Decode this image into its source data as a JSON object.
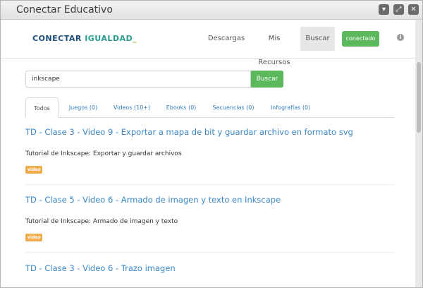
{
  "window": {
    "title": "Conectar Educativo",
    "buttons": [
      "▾",
      "⤢",
      "✕"
    ]
  },
  "header": {
    "logo": [
      "CONECTAR ",
      "IGUALDAD",
      "_"
    ],
    "nav": [
      "Descargas",
      "Mis Recursos",
      "Buscar"
    ],
    "status_button": "conectado",
    "info_icon": "i"
  },
  "search": {
    "value": "inkscape",
    "button": "Buscar"
  },
  "tabs": [
    "Todos",
    "Juegos (0)",
    "Videos (10+)",
    "Ebooks (0)",
    "Secuencias (0)",
    "Infografías (0)"
  ],
  "results": [
    {
      "title": "TD - Clase 3 - Video 9 - Exportar a mapa de bit y guardar archivo en formato svg",
      "description": "Tutorial de Inkscape: Exportar y guardar archivos",
      "badge": "video"
    },
    {
      "title": "TD - Clase 5 - Video 6 - Armado de imagen y texto en Inkscape",
      "description": "Tutorial de Inkscape: Armado de imagen y texto",
      "badge": "video"
    },
    {
      "title": "TD - Clase 3 - Video 6 - Trazo imagen"
    }
  ],
  "colors": {
    "accent_green": "#5cb85c",
    "link_blue": "#3a87c7",
    "badge_orange": "#f0ad4e"
  }
}
